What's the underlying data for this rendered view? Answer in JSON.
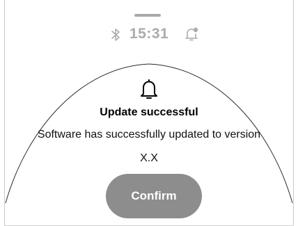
{
  "status_bar": {
    "time": "15:31",
    "bluetooth_icon": "bluetooth-icon",
    "notification_icon": "bell-with-dot-icon"
  },
  "dialog": {
    "icon": "bell-icon",
    "title": "Update successful",
    "message": "Software has successfully updated to version X.X",
    "confirm_label": "Confirm"
  },
  "colors": {
    "status_text": "#ababab",
    "button_bg": "#8d8d8d",
    "button_text": "#ffffff",
    "title_text": "#000000"
  }
}
